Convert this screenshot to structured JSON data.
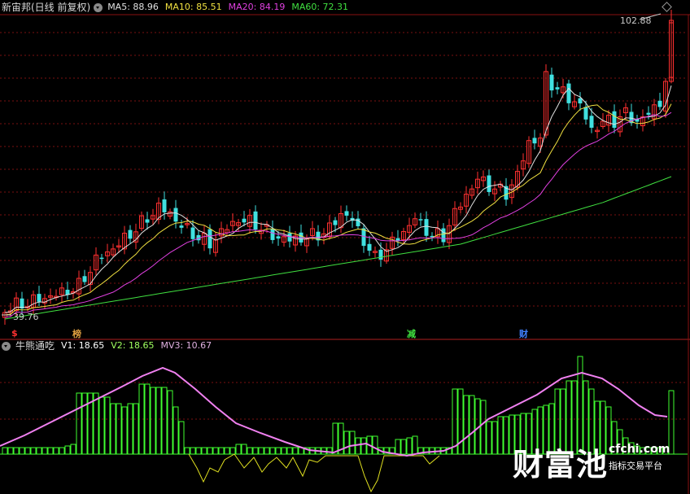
{
  "stock": {
    "title": "新宙邦(日线 前复权)"
  },
  "ma_legend": [
    {
      "label": "MA5: 88.96",
      "color": "#e0e0e0"
    },
    {
      "label": "MA10: 85.51",
      "color": "#f0e040"
    },
    {
      "label": "MA20: 84.19",
      "color": "#e040e0"
    },
    {
      "label": "MA60: 72.31",
      "color": "#40e040"
    }
  ],
  "price_high_label": "102.88",
  "price_low_label": "39.76",
  "markers": [
    {
      "text": "$",
      "color": "#ff3030"
    },
    {
      "text": "榜",
      "color": "#e0a040"
    },
    {
      "text": "减",
      "color": "#40e040"
    },
    {
      "text": "财",
      "color": "#4080ff"
    }
  ],
  "indicator": {
    "name": "牛熊通吃",
    "values": [
      {
        "label": "V1: 18.65",
        "color": "#ffffff"
      },
      {
        "label": "V2: 18.65",
        "color": "#a0ff60"
      },
      {
        "label": "MV3: 10.67",
        "color": "#e0b0e0"
      }
    ]
  },
  "watermark": {
    "big": "财富池",
    "site": "cfchi.com",
    "sub": "指标交易平台"
  },
  "colors": {
    "up": "#ff3030",
    "down": "#40e0e0",
    "grid": "#7a1010",
    "ma5": "#e0e0e0",
    "ma10": "#f0e040",
    "ma20": "#e040e0",
    "ma60": "#40e040",
    "bars": "#40ff30",
    "v2line": "#e0e020",
    "mv3": "#f080f0"
  }
}
